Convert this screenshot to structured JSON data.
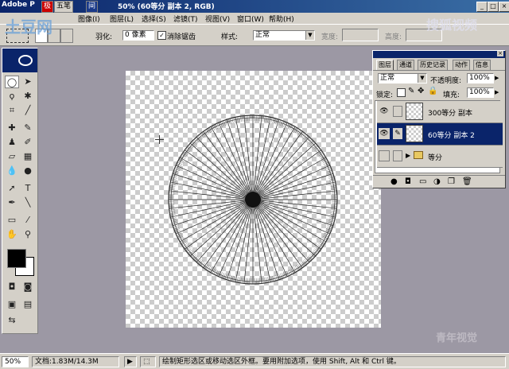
{
  "titlebar": {
    "title": "Adobe P",
    "doc_title": "50% (60等分 副本 2, RGB)",
    "ime_1": "极",
    "ime_2": "五笔",
    "ime_3": "间",
    "min_label": "_",
    "max_label": "□",
    "close_label": "×"
  },
  "watermarks": {
    "top_left": "土豆网",
    "top_right": "搜狐视频",
    "bottom_right": "青年视觉"
  },
  "menu": {
    "items": [
      "图像(I)",
      "图层(L)",
      "选择(S)",
      "滤镜(T)",
      "视图(V)",
      "窗口(W)",
      "帮助(H)"
    ]
  },
  "options": {
    "feather_label": "羽化:",
    "feather_value": "0 像素",
    "antialias_label": "消除锯齿",
    "antialias_checked": true,
    "style_label": "样式:",
    "style_value": "正常",
    "width_label": "宽度:",
    "height_label": "高度:"
  },
  "layers_panel": {
    "tabs": [
      "图层",
      "通道",
      "历史记录",
      "动作",
      "信息"
    ],
    "blend_mode": "正常",
    "opacity_label": "不透明度:",
    "opacity_value": "100%",
    "lock_label": "锁定:",
    "fill_label": "填充:",
    "fill_value": "100%",
    "layers": [
      {
        "name": "300等分 副本",
        "visible": true,
        "selected": false
      },
      {
        "name": "60等分 副本 2",
        "visible": true,
        "selected": true
      },
      {
        "name": "等分",
        "visible": false,
        "selected": false,
        "is_group": true
      }
    ]
  },
  "status": {
    "zoom": "50%",
    "doc_size": "文档:1.83M/14.3M",
    "hint": "绘制矩形选区或移动选区外框。要用附加选项，使用 Shift, Alt 和 Ctrl 键。"
  },
  "colors": {
    "title_bar": "#0a246a",
    "ui_face": "#d4d0c8",
    "workspace": "#9c98a4",
    "selection": "#0a246a"
  }
}
